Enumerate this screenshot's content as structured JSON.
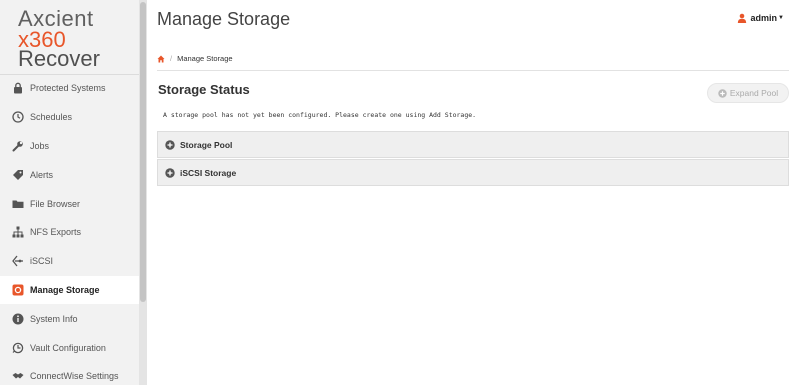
{
  "brand": {
    "line1": "Axcient",
    "line2": "x360",
    "line3": "Recover"
  },
  "colors": {
    "accent": "#e8562a",
    "sidebar_bg": "#f2f2f2"
  },
  "sidebar": {
    "items": [
      {
        "label": "Protected Systems",
        "icon": "lock-icon"
      },
      {
        "label": "Schedules",
        "icon": "clock-icon"
      },
      {
        "label": "Jobs",
        "icon": "wrench-icon"
      },
      {
        "label": "Alerts",
        "icon": "tag-icon"
      },
      {
        "label": "File Browser",
        "icon": "folder-icon"
      },
      {
        "label": "NFS Exports",
        "icon": "sitemap-icon"
      },
      {
        "label": "iSCSI",
        "icon": "iscsi-icon"
      },
      {
        "label": "Manage Storage",
        "icon": "storage-icon",
        "active": true
      },
      {
        "label": "System Info",
        "icon": "info-icon"
      },
      {
        "label": "Vault Configuration",
        "icon": "vault-icon"
      },
      {
        "label": "ConnectWise Settings",
        "icon": "handshake-icon"
      }
    ]
  },
  "header": {
    "title": "Manage Storage",
    "user": "admin"
  },
  "breadcrumb": {
    "home_icon": "home-icon",
    "current": "Manage Storage"
  },
  "storage": {
    "title": "Storage Status",
    "expand_button": "Expand Pool",
    "message": "A storage pool has not yet been configured. Please create one using Add Storage.",
    "panels": [
      "Storage Pool",
      "iSCSI Storage"
    ]
  }
}
